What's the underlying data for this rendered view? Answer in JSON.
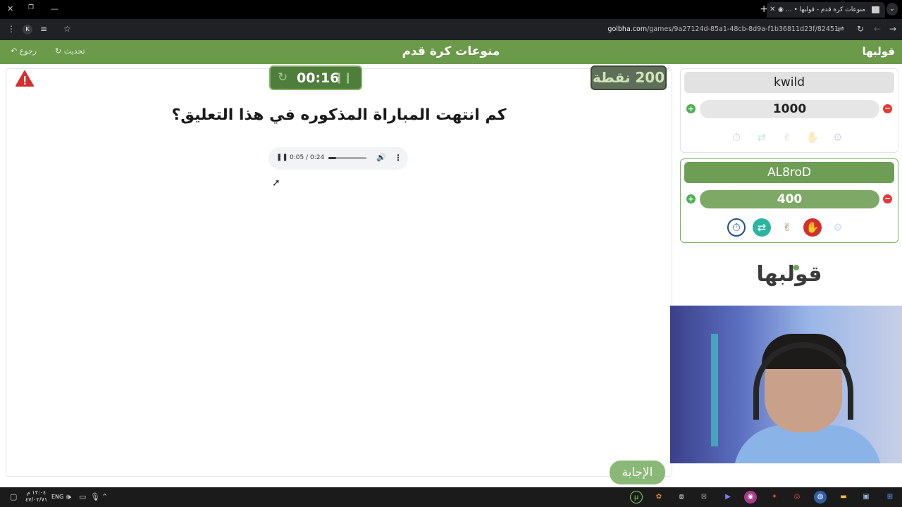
{
  "browser": {
    "tab_title": "منوعات كرة قدم - قولبها • ...",
    "url_domain": "golbha.com",
    "url_path": "/games/9a27124d-85a1-48cb-8d9a-f1b36811d23f/82451",
    "profile_initial": "K"
  },
  "header": {
    "title": "منوعات كرة قدم",
    "back_label": "رجوع",
    "refresh_label": "تحديث",
    "logo_text": "قولبها"
  },
  "game": {
    "timer": "00:16",
    "points": "200 نقطة",
    "question": "كم انتهت المباراة المذكوره في هذا التعليق؟",
    "answer_button": "الإجابة",
    "audio": {
      "time": "0:05 / 0:24",
      "progress": 0.21
    }
  },
  "teams": [
    {
      "name": "kwild",
      "score": "1000"
    },
    {
      "name": "AL8roD",
      "score": "400"
    }
  ],
  "brand_logo": "قولبها",
  "taskbar": {
    "time": "١٢:٠٤ م",
    "date": "٤٧/٠٢/٧١",
    "lang": "ENG"
  },
  "colors": {
    "header_green": "#6a9a4a",
    "timer_green": "#4f7d3c",
    "active_team": "#6e9d55",
    "answer_button": "#8ab877"
  }
}
